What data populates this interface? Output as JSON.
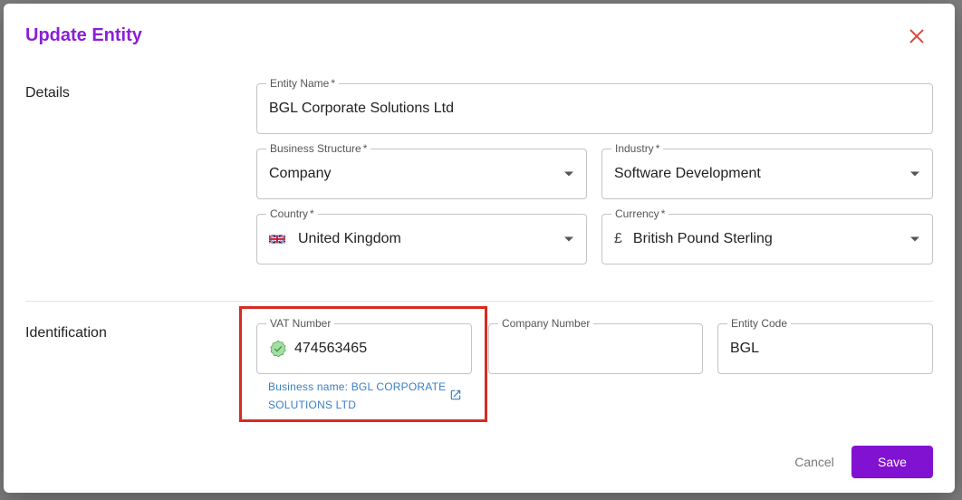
{
  "dialog": {
    "title": "Update Entity"
  },
  "sections": {
    "details": "Details",
    "identification": "Identification"
  },
  "fields": {
    "entity_name": {
      "label": "Entity Name",
      "required": "*",
      "value": "BGL Corporate Solutions Ltd"
    },
    "business_structure": {
      "label": "Business Structure",
      "required": "*",
      "value": "Company"
    },
    "industry": {
      "label": "Industry",
      "required": "*",
      "value": "Software Development"
    },
    "country": {
      "label": "Country",
      "required": "*",
      "value": "United Kingdom",
      "icon": "uk-flag-icon"
    },
    "currency": {
      "label": "Currency",
      "required": "*",
      "value": "British Pound Sterling",
      "symbol": "£"
    },
    "vat_number": {
      "label": "VAT Number",
      "value": "474563465",
      "icon": "verified-check-icon",
      "helper": "Business name: BGL CORPORATE SOLUTIONS LTD"
    },
    "company_number": {
      "label": "Company Number",
      "value": ""
    },
    "entity_code": {
      "label": "Entity Code",
      "value": "BGL"
    }
  },
  "actions": {
    "cancel": "Cancel",
    "save": "Save"
  },
  "colors": {
    "title": "#8b1fd6",
    "primary": "#8212d1",
    "highlight": "#d62b22",
    "link": "#3a7fc4",
    "close": "#e0463b"
  }
}
